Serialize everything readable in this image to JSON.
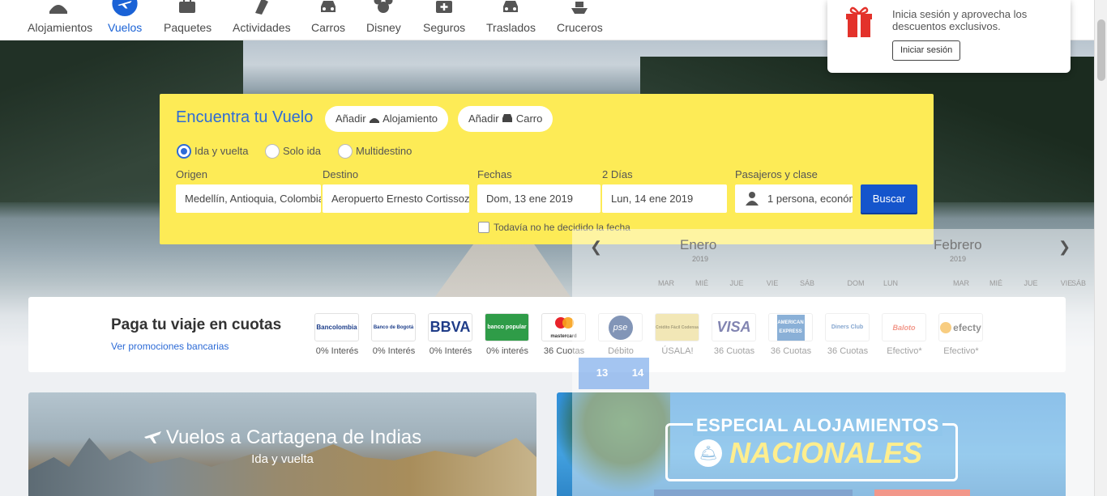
{
  "nav": {
    "items": [
      {
        "label": "Alojamientos",
        "icon": "bed-icon"
      },
      {
        "label": "Vuelos",
        "icon": "plane-icon"
      },
      {
        "label": "Paquetes",
        "icon": "suitcase-icon"
      },
      {
        "label": "Actividades",
        "icon": "ticket-icon"
      },
      {
        "label": "Carros",
        "icon": "car-icon"
      },
      {
        "label": "Disney",
        "icon": "mickey-icon"
      },
      {
        "label": "Seguros",
        "icon": "medkit-icon"
      },
      {
        "label": "Traslados",
        "icon": "car-icon"
      },
      {
        "label": "Cruceros",
        "icon": "ship-icon"
      }
    ],
    "active_color": "#1a62d6"
  },
  "login_popup": {
    "message": "Inicia sesión y aprovecha los descuentos exclusivos.",
    "button": "Iniciar sesión"
  },
  "search": {
    "title": "Encuentra tu Vuelo",
    "add_alojamiento_prefix": "Añadir",
    "add_alojamiento": "Alojamiento",
    "add_carro_prefix": "Añadir",
    "add_carro": "Carro",
    "trip_types": {
      "roundtrip": "Ida y vuelta",
      "oneway": "Solo ida",
      "multi": "Multidestino"
    },
    "selected_trip_type": "roundtrip",
    "origen_label": "Origen",
    "origen_value": "Medellín, Antioquia, Colombia",
    "destino_label": "Destino",
    "destino_value": "Aeropuerto Ernesto Cortissoz",
    "fechas_label": "Fechas",
    "fecha_ida": "Dom, 13 ene 2019",
    "dias_label": "2 Días",
    "fecha_vuelta": "Lun, 14 ene 2019",
    "pasajeros_label": "Pasajeros y clase",
    "pasajeros_value": "1 persona, económica",
    "buscar": "Buscar",
    "undecided": "Todavía no he decidido la fecha",
    "box_color": "#fdeb56",
    "button_color": "#1555cc"
  },
  "cuotas": {
    "title": "Paga tu viaje en cuotas",
    "link": "Ver promociones bancarias",
    "banks": [
      {
        "logo": "Bancolombia",
        "caption": "0% Interés"
      },
      {
        "logo": "Banco de Bogotá",
        "caption": "0% Interés"
      },
      {
        "logo": "BBVA",
        "caption": "0% Interés"
      },
      {
        "logo": "banco popular",
        "caption": "0% interés"
      },
      {
        "logo": "mastercard",
        "caption": "36 Cuotas"
      },
      {
        "logo": "pse",
        "caption": "Débito"
      },
      {
        "logo": "Crédito Fácil Codensa",
        "caption": "ÚSALA!"
      },
      {
        "logo": "VISA",
        "caption": "36 Cuotas"
      },
      {
        "logo": "AMERICAN EXPRESS",
        "caption": "36 Cuotas"
      },
      {
        "logo": "Diners Club",
        "caption": "36 Cuotas"
      },
      {
        "logo": "Baloto",
        "caption": "Efectivo*"
      },
      {
        "logo": "efecty",
        "caption": "Efectivo*"
      }
    ]
  },
  "calendar": {
    "month1": "Enero",
    "year1": "2019",
    "month2": "Febrero",
    "year2": "2019",
    "dow": [
      "MAR",
      "MIÉ",
      "JUE",
      "VIE",
      "SÁB",
      "DOM",
      "LUN",
      "MAR",
      "MIÉ",
      "JUE",
      "VIE",
      "SÁB"
    ],
    "selected": [
      "13",
      "14"
    ]
  },
  "cards": {
    "cartagena_title": "Vuelos a Cartagena de Indias",
    "cartagena_sub": "Ida y vuelta",
    "promo_line1": "ESPECIAL ALOJAMIENTOS",
    "promo_line2": "NACIONALES"
  }
}
